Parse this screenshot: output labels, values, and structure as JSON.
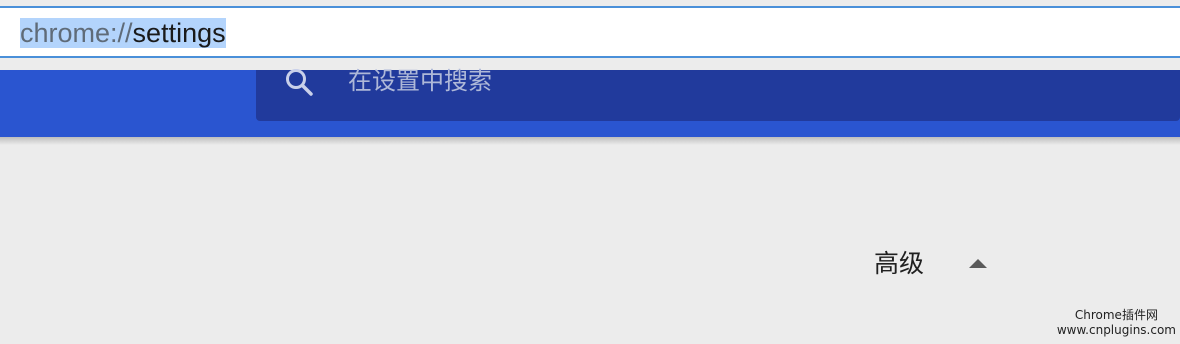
{
  "address_bar": {
    "scheme": "chrome://",
    "path": "settings"
  },
  "search": {
    "icon": "search-icon",
    "placeholder": "在设置中搜索"
  },
  "advanced": {
    "label": "高级",
    "icon": "triangle-up-icon"
  },
  "watermark": {
    "line1": "Chrome插件网",
    "line2": "www.cnplugins.com"
  },
  "colors": {
    "header_blue": "#2a55d0",
    "search_box": "#213a9c",
    "page_bg": "#ececec",
    "address_border": "#4a90d9",
    "selection": "#b3d4fc"
  }
}
